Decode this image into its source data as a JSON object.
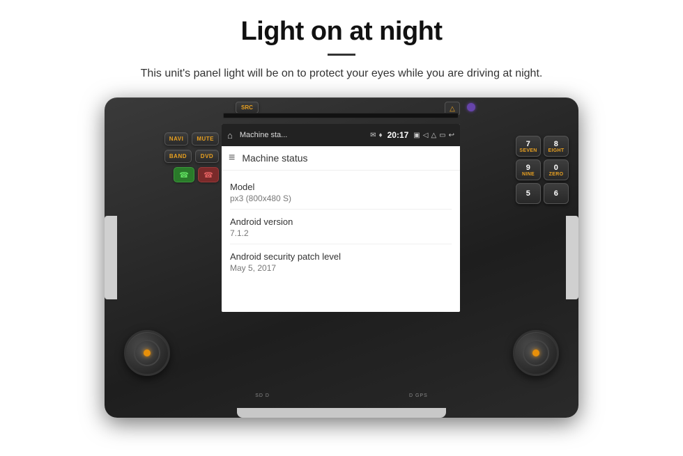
{
  "header": {
    "title": "Light on at night",
    "subtitle": "This unit's panel light will be on to protect your eyes while you are driving at night."
  },
  "device": {
    "cd_slot": true,
    "src_button": "SRC",
    "left_buttons": [
      {
        "label": "NAVI"
      },
      {
        "label": "MUTE"
      },
      {
        "label": "BAND"
      },
      {
        "label": "DVD"
      }
    ],
    "right_buttons": [
      {
        "top": "SEVEN",
        "num": "7"
      },
      {
        "top": "EIGHT",
        "num": "8"
      },
      {
        "top": "NINE",
        "num": "9"
      },
      {
        "top": "ZERO",
        "num": "0"
      },
      {
        "top": "",
        "num": "5"
      },
      {
        "top": "",
        "num": "6"
      }
    ]
  },
  "android_screen": {
    "status_bar": {
      "app_name": "Machine sta...",
      "time": "20:17"
    },
    "toolbar_title": "Machine status",
    "info_items": [
      {
        "label": "Model",
        "value": "px3 (800x480 S)"
      },
      {
        "label": "Android version",
        "value": "7.1.2"
      },
      {
        "label": "Android security patch level",
        "value": "May 5, 2017"
      }
    ]
  },
  "icons": {
    "home": "⌂",
    "menu": "≡",
    "phone_answer": "📞",
    "phone_hangup": "📵"
  }
}
